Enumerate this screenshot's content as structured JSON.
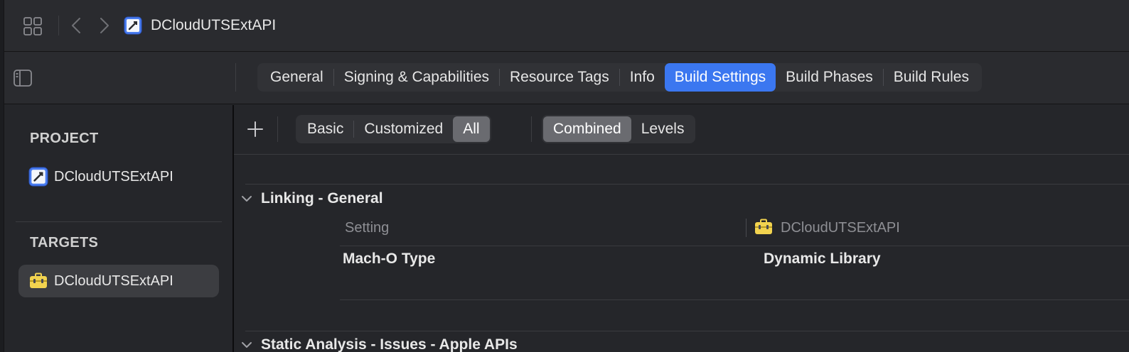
{
  "toolbar": {
    "title": "DCloudUTSExtAPI",
    "icons": [
      "grid-icon",
      "chevron-left-icon",
      "chevron-right-icon",
      "project-icon"
    ]
  },
  "editor_tabs": [
    {
      "label": "General",
      "active": false
    },
    {
      "label": "Signing & Capabilities",
      "active": false
    },
    {
      "label": "Resource Tags",
      "active": false
    },
    {
      "label": "Info",
      "active": false
    },
    {
      "label": "Build Settings",
      "active": true
    },
    {
      "label": "Build Phases",
      "active": false
    },
    {
      "label": "Build Rules",
      "active": false
    }
  ],
  "sidebar": {
    "project_header": "PROJECT",
    "project_item": "DCloudUTSExtAPI",
    "targets_header": "TARGETS",
    "target_item": "DCloudUTSExtAPI"
  },
  "filters": {
    "scope": [
      "Basic",
      "Customized",
      "All"
    ],
    "scope_selected": "All",
    "view": [
      "Combined",
      "Levels"
    ],
    "view_selected": "Combined"
  },
  "settings": {
    "group1": "Linking - General",
    "col_setting": "Setting",
    "col_target": "DCloudUTSExtAPI",
    "row_key": "Mach-O Type",
    "row_value": "Dynamic Library",
    "group2": "Static Analysis - Issues - Apple APIs"
  },
  "colors": {
    "accent": "#3b77f0",
    "background": "#25262a",
    "toolbox_yellow": "#f2d34f"
  }
}
